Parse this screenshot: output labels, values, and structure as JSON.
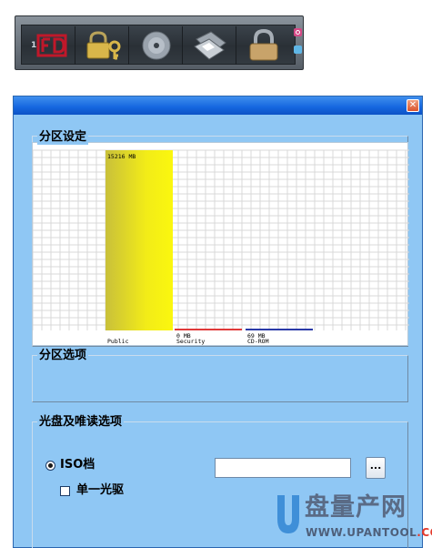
{
  "toolbar": {
    "buttons": [
      {
        "icon": "fd-logo-icon",
        "label": "FD"
      },
      {
        "icon": "lock-key-icon"
      },
      {
        "icon": "cd-disc-icon"
      },
      {
        "icon": "floppy-disks-icon"
      },
      {
        "icon": "padlock-icon"
      }
    ],
    "side_icons": [
      "power-icon",
      "eject-icon"
    ],
    "number_marker": "1"
  },
  "dialog": {
    "close_glyph": "✕",
    "partition_settings": {
      "label": "分区设定",
      "chart_data": {
        "type": "bar",
        "categories": [
          "Public",
          "Security",
          "CD-ROM"
        ],
        "values": [
          15216,
          0,
          69
        ],
        "value_labels": [
          "15216 MB",
          "0 MB",
          "69 MB"
        ],
        "unit": "MB",
        "colors": [
          "#e6dc1e",
          "#e03a3a",
          "#2a3aa8"
        ],
        "ylim": [
          0,
          15216
        ],
        "grid": true
      }
    },
    "partition_options": {
      "label": "分区选项"
    },
    "cd_readonly": {
      "label": "光盘及唯读选项",
      "iso_label": "ISO档",
      "iso_selected": true,
      "iso_path": "",
      "browse_label": "...",
      "single_drive_label": "单一光驱",
      "single_drive_checked": false
    }
  },
  "watermark": {
    "title": "盘量产网",
    "site_main": "WWW.UPANTOOL",
    "site_suffix": ".COM"
  }
}
